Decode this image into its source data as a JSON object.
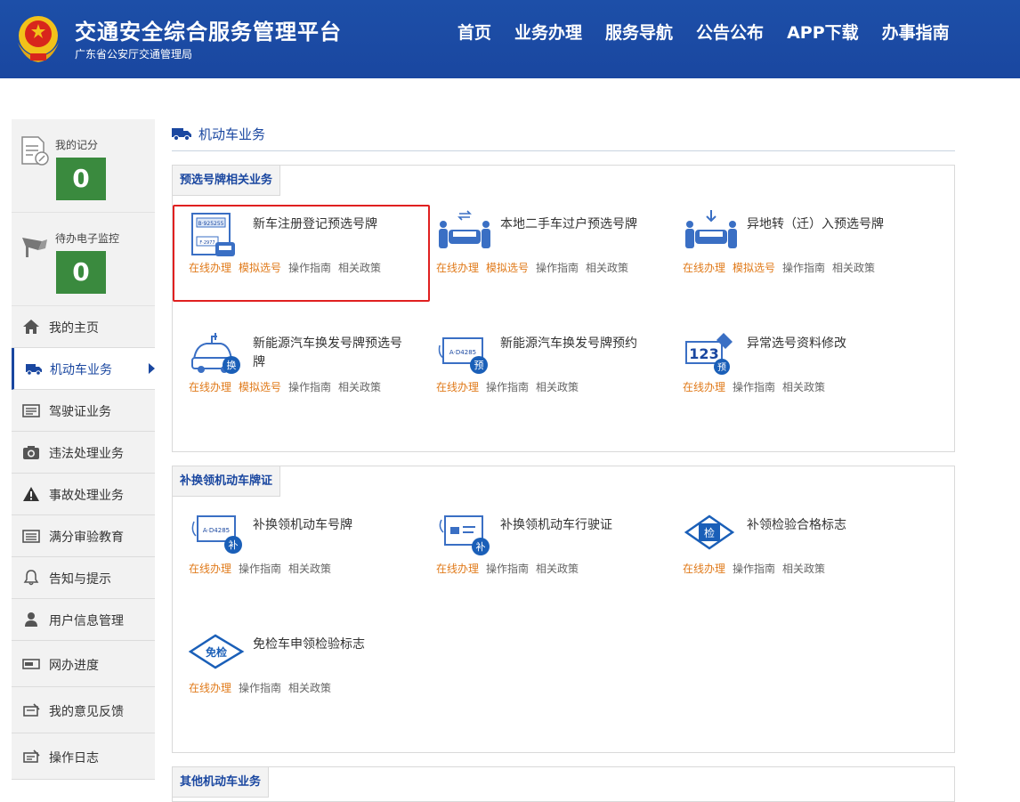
{
  "header": {
    "title": "交通安全综合服务管理平台",
    "subtitle": "广东省公安厅交通管理局",
    "nav": [
      "首页",
      "业务办理",
      "服务导航",
      "公告公布",
      "APP下载",
      "办事指南"
    ]
  },
  "sidebar": {
    "stats": [
      {
        "label": "我的记分",
        "value": "0",
        "icon": "document-edit-icon"
      },
      {
        "label": "待办电子监控",
        "value": "0",
        "icon": "camera-monitor-icon"
      }
    ],
    "items": [
      {
        "label": "我的主页",
        "icon": "home-icon"
      },
      {
        "label": "机动车业务",
        "icon": "truck-icon",
        "active": true
      },
      {
        "label": "驾驶证业务",
        "icon": "license-card-icon"
      },
      {
        "label": "违法处理业务",
        "icon": "camera-icon"
      },
      {
        "label": "事故处理业务",
        "icon": "warning-icon"
      },
      {
        "label": "满分审验教育",
        "icon": "list-card-icon"
      },
      {
        "label": "告知与提示",
        "icon": "bell-icon"
      },
      {
        "label": "用户信息管理",
        "icon": "user-icon"
      },
      {
        "label": "网办进度",
        "icon": "progress-icon"
      },
      {
        "label": "我的意见反馈",
        "icon": "feedback-icon"
      },
      {
        "label": "操作日志",
        "icon": "log-icon"
      }
    ]
  },
  "main": {
    "heading": "机动车业务",
    "panels": [
      {
        "tab": "预选号牌相关业务",
        "services": [
          {
            "title": "新车注册登记预选号牌",
            "icon": "new-plate-icon",
            "plate_text_1": "B·925255",
            "plate_text_2": "F·2977",
            "links": [
              {
                "text": "在线办理",
                "style": "orange"
              },
              {
                "text": "模拟选号",
                "style": "orange"
              },
              {
                "text": "操作指南",
                "style": "gray"
              },
              {
                "text": "相关政策",
                "style": "gray"
              }
            ]
          },
          {
            "title": "本地二手车过户预选号牌",
            "icon": "transfer-car-icon",
            "links": [
              {
                "text": "在线办理",
                "style": "orange"
              },
              {
                "text": "模拟选号",
                "style": "orange"
              },
              {
                "text": "操作指南",
                "style": "gray"
              },
              {
                "text": "相关政策",
                "style": "gray"
              }
            ]
          },
          {
            "title": "异地转（迁）入预选号牌",
            "icon": "relocate-car-icon",
            "links": [
              {
                "text": "在线办理",
                "style": "orange"
              },
              {
                "text": "模拟选号",
                "style": "orange"
              },
              {
                "text": "操作指南",
                "style": "gray"
              },
              {
                "text": "相关政策",
                "style": "gray"
              }
            ]
          },
          {
            "title": "新能源汽车换发号牌预选号牌",
            "icon": "ev-car-icon",
            "badge": "换",
            "links": [
              {
                "text": "在线办理",
                "style": "orange"
              },
              {
                "text": "模拟选号",
                "style": "orange"
              },
              {
                "text": "操作指南",
                "style": "gray"
              },
              {
                "text": "相关政策",
                "style": "gray"
              }
            ]
          },
          {
            "title": "新能源汽车换发号牌预约",
            "icon": "ev-plate-icon",
            "badge": "预",
            "plate_text": "A·D4285",
            "links": [
              {
                "text": "在线办理",
                "style": "orange"
              },
              {
                "text": "操作指南",
                "style": "gray"
              },
              {
                "text": "相关政策",
                "style": "gray"
              }
            ]
          },
          {
            "title": "异常选号资料修改",
            "icon": "number-edit-icon",
            "badge": "预",
            "number_text": "123",
            "links": [
              {
                "text": "在线办理",
                "style": "orange"
              },
              {
                "text": "操作指南",
                "style": "gray"
              },
              {
                "text": "相关政策",
                "style": "gray"
              }
            ]
          }
        ]
      },
      {
        "tab": "补换领机动车牌证",
        "services": [
          {
            "title": "补换领机动车号牌",
            "icon": "replace-plate-icon",
            "badge": "补",
            "plate_text": "A·D4285",
            "links": [
              {
                "text": "在线办理",
                "style": "orange"
              },
              {
                "text": "操作指南",
                "style": "gray"
              },
              {
                "text": "相关政策",
                "style": "gray"
              }
            ]
          },
          {
            "title": "补换领机动车行驶证",
            "icon": "replace-license-icon",
            "badge": "补",
            "links": [
              {
                "text": "在线办理",
                "style": "orange"
              },
              {
                "text": "操作指南",
                "style": "gray"
              },
              {
                "text": "相关政策",
                "style": "gray"
              }
            ]
          },
          {
            "title": "补领检验合格标志",
            "icon": "inspection-mark-icon",
            "badge": "检",
            "links": [
              {
                "text": "在线办理",
                "style": "orange"
              },
              {
                "text": "操作指南",
                "style": "gray"
              },
              {
                "text": "相关政策",
                "style": "gray"
              }
            ]
          },
          {
            "title": "免检车申领检验标志",
            "icon": "exempt-mark-icon",
            "badge": "免检",
            "links": [
              {
                "text": "在线办理",
                "style": "orange"
              },
              {
                "text": "操作指南",
                "style": "gray"
              },
              {
                "text": "相关政策",
                "style": "gray"
              }
            ]
          }
        ]
      },
      {
        "tab": "其他机动车业务",
        "services": []
      }
    ]
  },
  "colors": {
    "brand": "#1a47a0",
    "link_orange": "#e07a1a",
    "score_green": "#3a8a3e",
    "highlight_red": "#e02020"
  }
}
